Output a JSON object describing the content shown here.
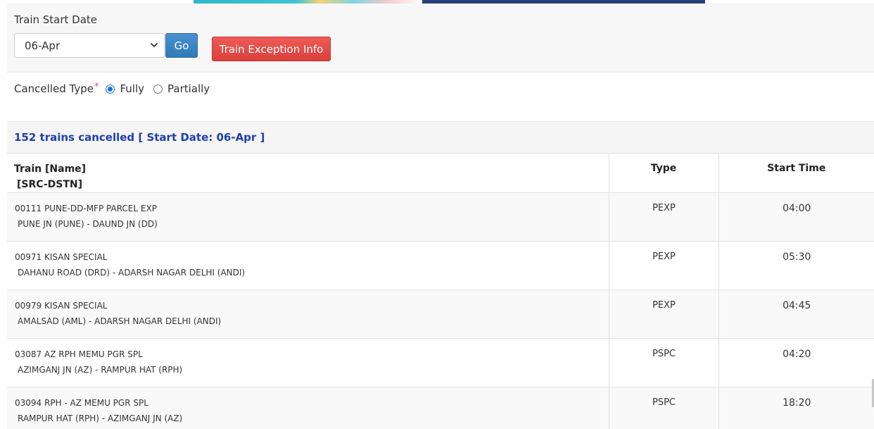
{
  "filter": {
    "label": "Train Start Date",
    "selected_date": "06-Apr",
    "go_label": "Go",
    "exception_label": "Train Exception Info"
  },
  "cancelled_type": {
    "label": "Cancelled Type",
    "required_mark": "*",
    "options": [
      {
        "label": "Fully",
        "checked": true
      },
      {
        "label": "Partially",
        "checked": false
      }
    ]
  },
  "summary": "152 trains cancelled [ Start Date: 06-Apr ]",
  "table": {
    "headers": {
      "train_line1": "Train [Name]",
      "train_line2": "[SRC-DSTN]",
      "type": "Type",
      "start_time": "Start Time"
    },
    "rows": [
      {
        "name": "00111 PUNE-DD-MFP PARCEL EXP",
        "route": "PUNE JN (PUNE) - DAUND JN (DD)",
        "type": "PEXP",
        "time": "04:00"
      },
      {
        "name": "00971 KISAN SPECIAL",
        "route": "DAHANU ROAD (DRD) - ADARSH NAGAR DELHI (ANDI)",
        "type": "PEXP",
        "time": "05:30"
      },
      {
        "name": "00979 KISAN SPECIAL",
        "route": "AMALSAD (AML) - ADARSH NAGAR DELHI (ANDI)",
        "type": "PEXP",
        "time": "04:45"
      },
      {
        "name": "03087 AZ RPH MEMU PGR SPL",
        "route": "AZIMGANJ JN (AZ) - RAMPUR HAT (RPH)",
        "type": "PSPC",
        "time": "04:20"
      },
      {
        "name": "03094 RPH - AZ MEMU PGR SPL",
        "route": "RAMPUR HAT (RPH) - AZIMGANJ JN (AZ)",
        "type": "PSPC",
        "time": "18:20"
      }
    ]
  },
  "colors": {
    "go_button": "#337ab7",
    "exception_button": "#d9534f",
    "summary_text": "#1f3fae",
    "radio_accent": "#1a6fe0"
  }
}
